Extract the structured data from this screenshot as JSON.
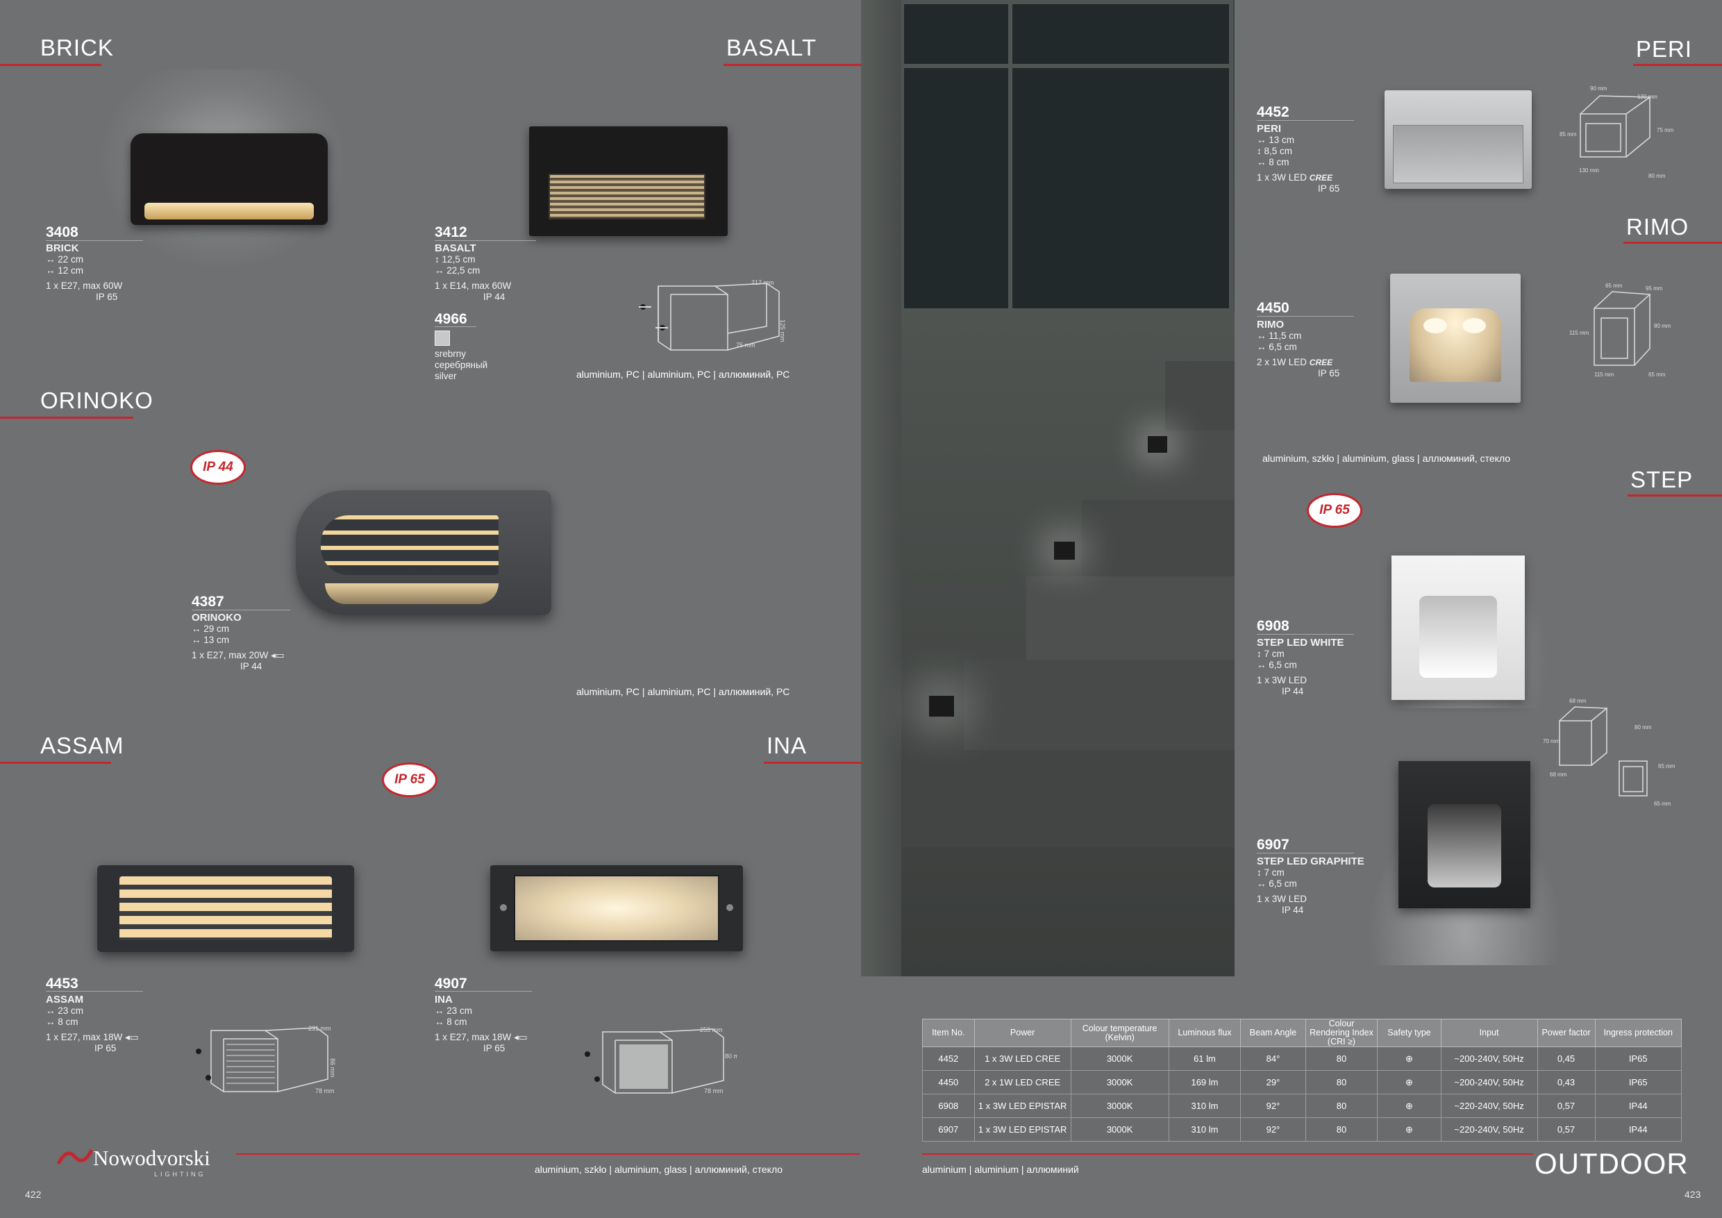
{
  "sections": {
    "brick": "BRICK",
    "basalt": "BASALT",
    "orinoko": "ORINOKO",
    "assam": "ASSAM",
    "ina": "INA",
    "peri": "PERI",
    "rimo": "RIMO",
    "step": "STEP"
  },
  "products": {
    "p3408": {
      "code": "3408",
      "name": "BRICK",
      "dim1": "↔ 22 cm",
      "dim2": "↔ 12 cm",
      "power": "1 x E27, max 60W",
      "ip": "IP 65"
    },
    "p3412": {
      "code": "3412",
      "name": "BASALT",
      "dim1": "↕ 12,5 cm",
      "dim2": "↔ 22,5 cm",
      "power": "1 x E14, max 60W",
      "ip": "IP 44"
    },
    "p4966": {
      "code": "4966",
      "c1": "srebrny",
      "c2": "серебряный",
      "c3": "silver"
    },
    "p4387": {
      "code": "4387",
      "name": "ORINOKO",
      "dim1": "↔ 29 cm",
      "dim2": "↔ 13 cm",
      "power": "1 x E27, max 20W",
      "ip": "IP 44"
    },
    "p4453": {
      "code": "4453",
      "name": "ASSAM",
      "dim1": "↔ 23 cm",
      "dim2": "↔ 8 cm",
      "power": "1 x E27, max 18W",
      "ip": "IP 65"
    },
    "p4907": {
      "code": "4907",
      "name": "INA",
      "dim1": "↔ 23 cm",
      "dim2": "↔ 8 cm",
      "power": "1 x E27, max 18W",
      "ip": "IP 65"
    },
    "p4452": {
      "code": "4452",
      "name": "PERI",
      "dim1": "↔ 13 cm",
      "dim2": "↕ 8,5 cm",
      "dim3": "↔ 8 cm",
      "power": "1 x 3W LED",
      "brand": "CREE",
      "ip": "IP 65"
    },
    "p4450": {
      "code": "4450",
      "name": "RIMO",
      "dim1": "↔ 11,5 cm",
      "dim2": "↔ 6,5 cm",
      "power": "2 x 1W LED",
      "brand": "CREE",
      "ip": "IP 65"
    },
    "p6908": {
      "code": "6908",
      "name": "STEP LED WHITE",
      "dim1": "↕ 7 cm",
      "dim2": "↔ 6,5 cm",
      "power": "1 x 3W LED",
      "ip": "IP 44"
    },
    "p6907": {
      "code": "6907",
      "name": "STEP LED GRAPHITE",
      "dim1": "↕ 7 cm",
      "dim2": "↔ 6,5 cm",
      "power": "1 x 3W LED",
      "ip": "IP 44"
    }
  },
  "badges": {
    "b1": "IP 44",
    "b2": "IP 65",
    "b3": "IP 65"
  },
  "materials": {
    "basalt": "aluminium, PC  |  aluminium, PC  |  аллюминий, PC",
    "orinoko": "aluminium, PC  |  aluminium, PC  |  аллюминий, PC",
    "assam_ina": "aluminium, szkło  |  aluminium, glass  |  аллюминий, стекло",
    "peri_rimo": "aluminium, szkło  |  aluminium, glass  |  аллюминий, стекло",
    "step": "aluminium  |  aluminium  |  аллюминий"
  },
  "drawings": {
    "basalt": {
      "w": "217 mm",
      "h": "125 mm",
      "d": "75 mm"
    },
    "assam": {
      "w": "231 mm",
      "h": "86 mm",
      "d": "78 mm"
    },
    "ina": {
      "w": "253 mm",
      "h": "80 mm",
      "d": "78 mm"
    },
    "peri": {
      "a": "90 mm",
      "b": "120 mm",
      "c": "85 mm",
      "d": "75 mm",
      "e": "130 mm",
      "f": "80 mm"
    },
    "rimo": {
      "a": "65 mm",
      "b": "95 mm",
      "c": "115 mm",
      "d": "80 mm",
      "e": "115 mm",
      "f": "65 mm"
    },
    "step": {
      "a": "68 mm",
      "b": "80 mm",
      "c": "65 mm",
      "d": "68 mm",
      "e": "65 mm",
      "f": "70 mm"
    }
  },
  "table": {
    "headers": [
      "Item No.",
      "Power",
      "Colour temperature (Kelvin)",
      "Luminous flux",
      "Beam Angle",
      "Colour Rendering Index (CRI ≥)",
      "Safety type",
      "Input",
      "Power factor",
      "Ingress protection"
    ],
    "rows": [
      [
        "4452",
        "1 x 3W LED CREE",
        "3000K",
        "61 lm",
        "84°",
        "80",
        "⊕",
        "~200-240V, 50Hz",
        "0,45",
        "IP65"
      ],
      [
        "4450",
        "2 x 1W LED CREE",
        "3000K",
        "169 lm",
        "29°",
        "80",
        "⊕",
        "~200-240V, 50Hz",
        "0,43",
        "IP65"
      ],
      [
        "6908",
        "1 x 3W LED EPISTAR",
        "3000K",
        "310 lm",
        "92°",
        "80",
        "⊕",
        "~220-240V, 50Hz",
        "0,57",
        "IP44"
      ],
      [
        "6907",
        "1 x 3W LED EPISTAR",
        "3000K",
        "310 lm",
        "92°",
        "80",
        "⊕",
        "~220-240V, 50Hz",
        "0,57",
        "IP44"
      ]
    ]
  },
  "footer": {
    "brand": "Nowodvorski",
    "brand_sub": "LIGHTING",
    "page_left": "422",
    "page_right": "423",
    "category": "OUTDOOR"
  },
  "colors": {
    "accent": "#c4262e",
    "background": "#6f7072"
  }
}
